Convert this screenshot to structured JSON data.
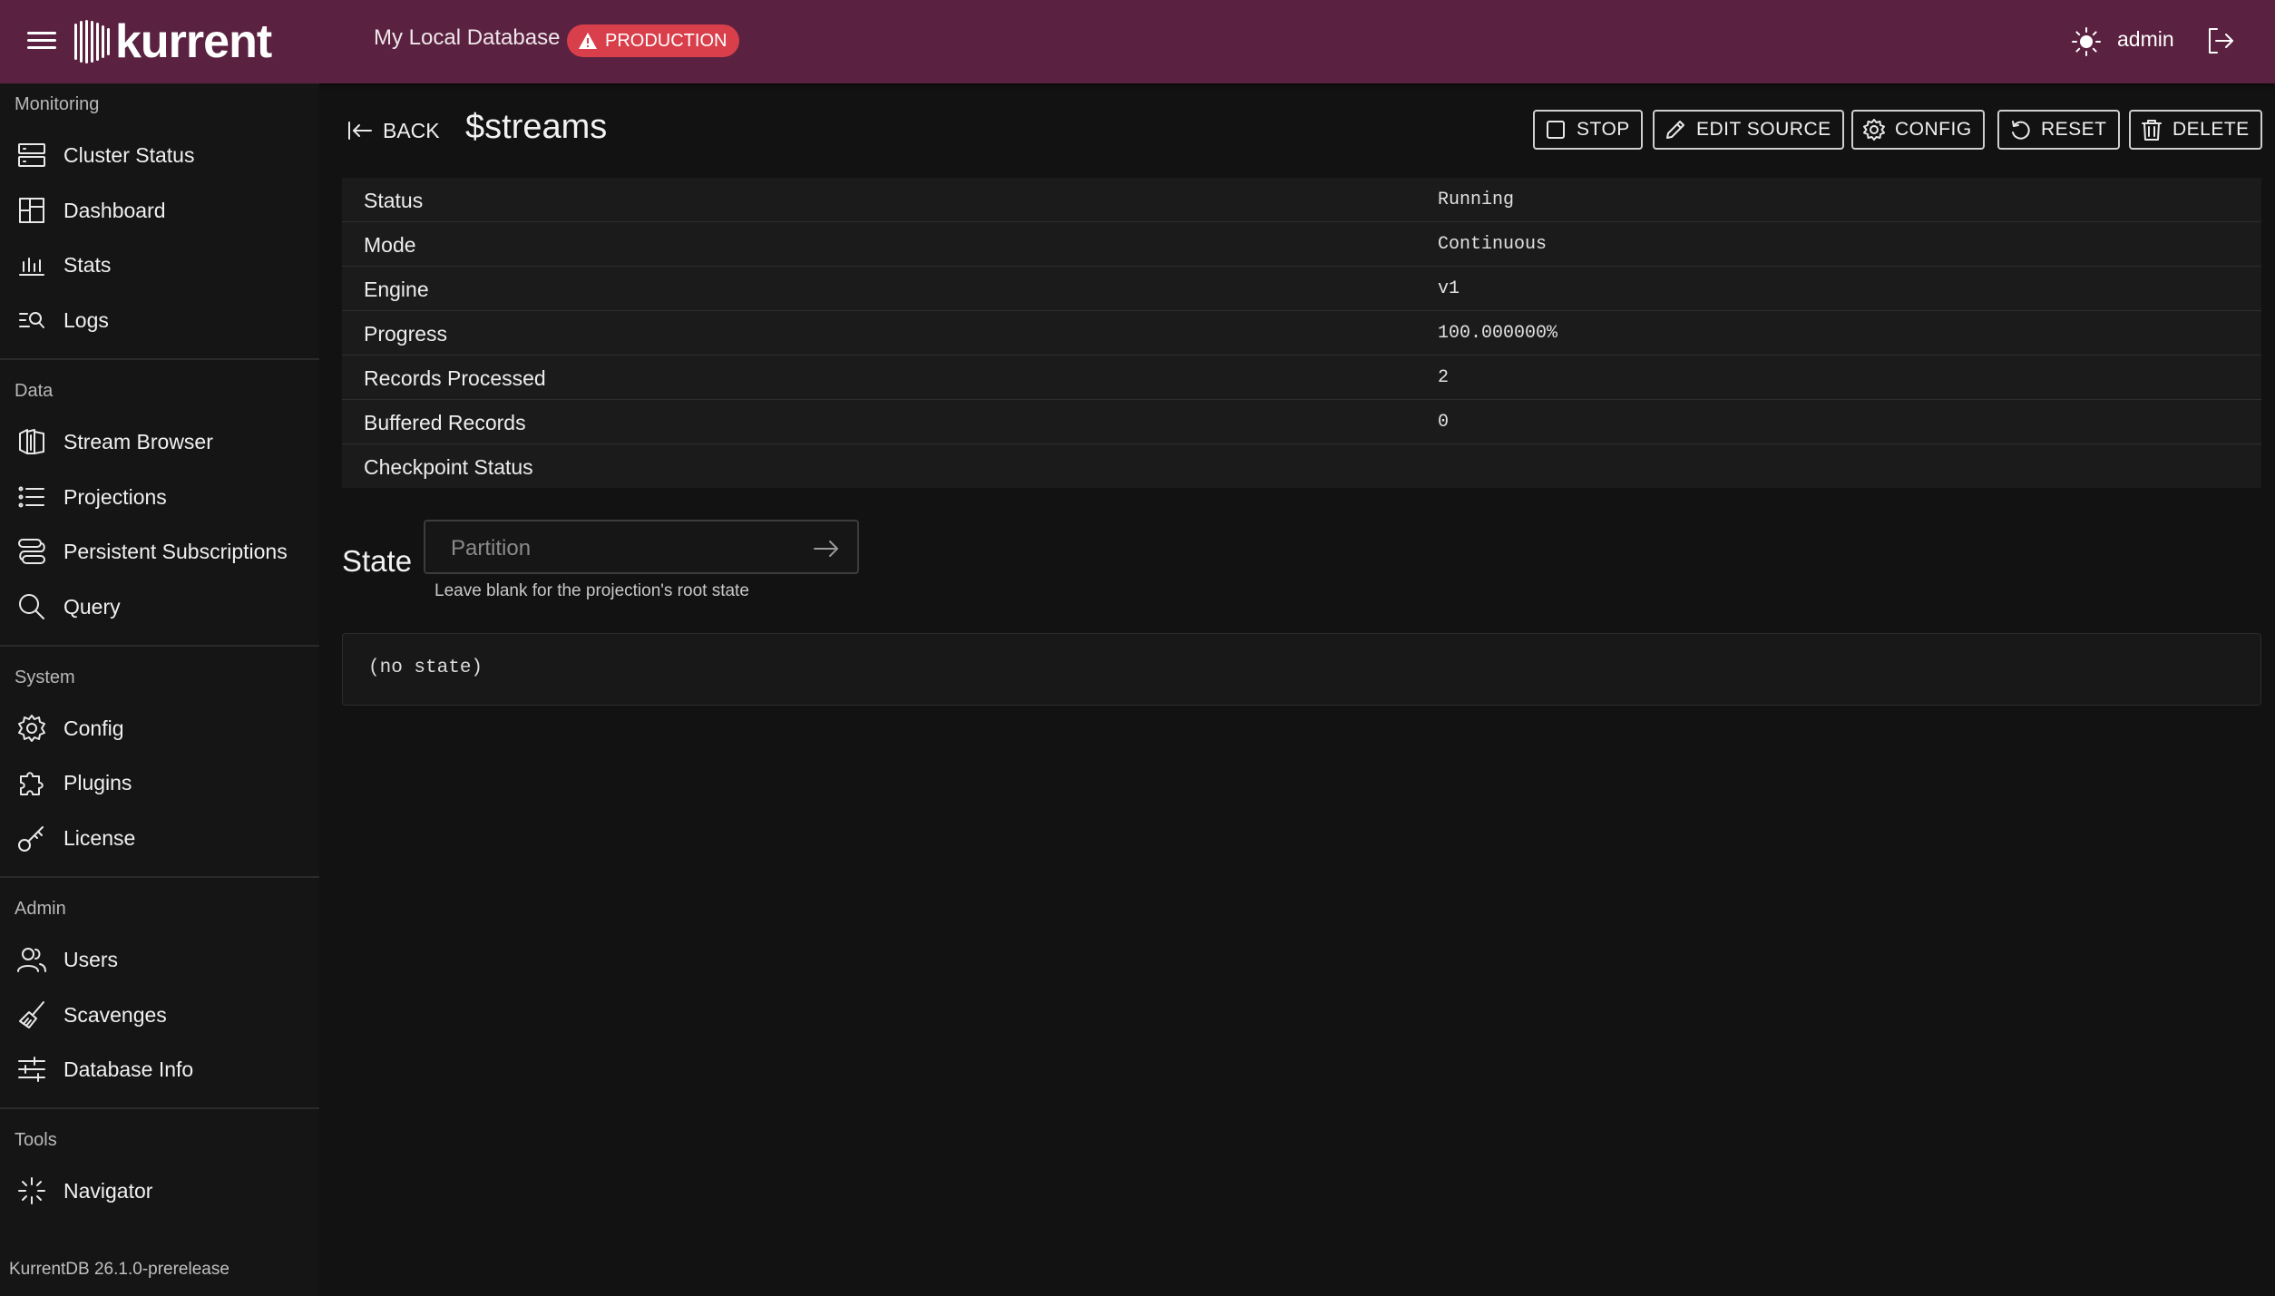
{
  "header": {
    "logo_text": "kurrent",
    "database_name": "My Local Database",
    "environment_badge": "PRODUCTION",
    "user": "admin"
  },
  "sidebar": {
    "sections": [
      {
        "title": "Monitoring",
        "items": [
          {
            "label": "Cluster Status",
            "icon": "server-icon"
          },
          {
            "label": "Dashboard",
            "icon": "dashboard-icon"
          },
          {
            "label": "Stats",
            "icon": "bar-chart-icon"
          },
          {
            "label": "Logs",
            "icon": "logs-search-icon"
          }
        ]
      },
      {
        "title": "Data",
        "items": [
          {
            "label": "Stream Browser",
            "icon": "stream-icon"
          },
          {
            "label": "Projections",
            "icon": "list-icon"
          },
          {
            "label": "Persistent Subscriptions",
            "icon": "subscription-icon"
          },
          {
            "label": "Query",
            "icon": "search-icon"
          }
        ]
      },
      {
        "title": "System",
        "items": [
          {
            "label": "Config",
            "icon": "gear-icon"
          },
          {
            "label": "Plugins",
            "icon": "puzzle-icon"
          },
          {
            "label": "License",
            "icon": "key-icon"
          }
        ]
      },
      {
        "title": "Admin",
        "items": [
          {
            "label": "Users",
            "icon": "users-icon"
          },
          {
            "label": "Scavenges",
            "icon": "broom-icon"
          },
          {
            "label": "Database Info",
            "icon": "sliders-icon"
          }
        ]
      },
      {
        "title": "Tools",
        "items": [
          {
            "label": "Navigator",
            "icon": "navigator-icon"
          }
        ]
      }
    ],
    "version": "KurrentDB 26.1.0-prerelease"
  },
  "main": {
    "back_label": "BACK",
    "title": "$streams",
    "toolbar": {
      "stop": "STOP",
      "edit_source": "EDIT SOURCE",
      "config": "CONFIG",
      "reset": "RESET",
      "delete": "DELETE"
    },
    "properties": [
      {
        "key": "Status",
        "value": "Running"
      },
      {
        "key": "Mode",
        "value": "Continuous"
      },
      {
        "key": "Engine",
        "value": "v1"
      },
      {
        "key": "Progress",
        "value": "100.000000%"
      },
      {
        "key": "Records Processed",
        "value": "2"
      },
      {
        "key": "Buffered Records",
        "value": "0"
      },
      {
        "key": "Checkpoint Status",
        "value": ""
      }
    ],
    "state": {
      "label": "State",
      "partition_placeholder": "Partition",
      "helper": "Leave blank for the projection's root state",
      "content": "(no state)"
    }
  },
  "colors": {
    "topbar": "#5a2240",
    "badge": "#d93f4a",
    "background": "#121212"
  }
}
